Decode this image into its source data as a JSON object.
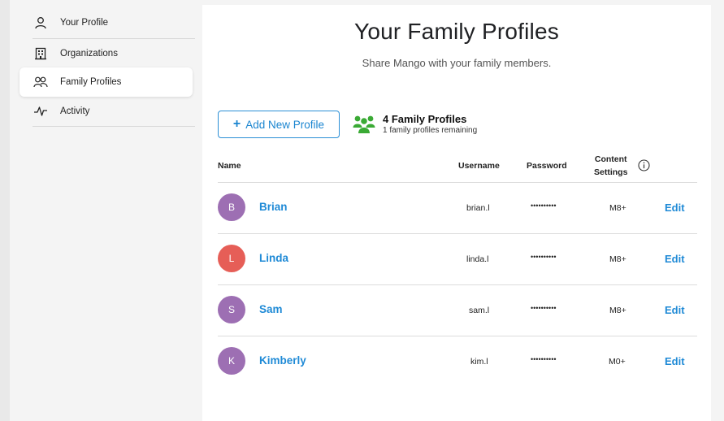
{
  "sidebar": {
    "items": [
      {
        "label": "Your Profile",
        "icon": "person-icon"
      },
      {
        "label": "Organizations",
        "icon": "building-icon"
      },
      {
        "label": "Family Profiles",
        "icon": "people-icon"
      },
      {
        "label": "Activity",
        "icon": "activity-icon"
      }
    ],
    "active_index": 2
  },
  "main": {
    "title": "Your Family Profiles",
    "subtitle": "Share Mango with your family members.",
    "add_button_label": "Add New Profile",
    "count_title": "4 Family Profiles",
    "count_subtitle": "1 family profiles remaining"
  },
  "table": {
    "headers": {
      "name": "Name",
      "username": "Username",
      "password": "Password",
      "content_line1": "Content",
      "content_line2": "Settings"
    },
    "rows": [
      {
        "initial": "B",
        "name": "Brian",
        "username": "brian.l",
        "password": "••••••••••",
        "content": "M8+",
        "edit": "Edit",
        "avatar_color": "#9d6fb3"
      },
      {
        "initial": "L",
        "name": "Linda",
        "username": "linda.l",
        "password": "••••••••••",
        "content": "M8+",
        "edit": "Edit",
        "avatar_color": "#e65e57"
      },
      {
        "initial": "S",
        "name": "Sam",
        "username": "sam.l",
        "password": "••••••••••",
        "content": "M8+",
        "edit": "Edit",
        "avatar_color": "#9d6fb3"
      },
      {
        "initial": "K",
        "name": "Kimberly",
        "username": "kim.l",
        "password": "••••••••••",
        "content": "M0+",
        "edit": "Edit",
        "avatar_color": "#9d6fb3"
      }
    ]
  },
  "colors": {
    "accent": "#1f8ad6",
    "people_icon": "#3aaa35"
  }
}
